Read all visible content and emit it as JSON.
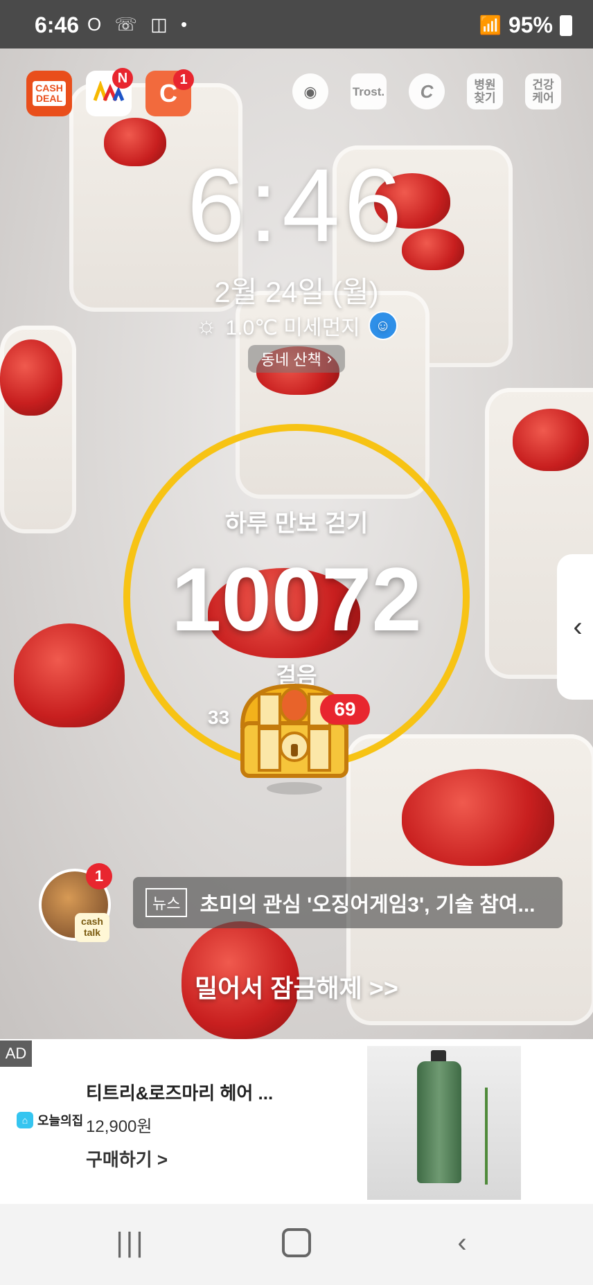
{
  "status_bar": {
    "time": "6:46",
    "left_icons": "O ☏ ◫ •",
    "battery": "95%"
  },
  "apps": [
    {
      "name": "CASH DEAL",
      "label": "CASH\nDEAL",
      "badge": ""
    },
    {
      "name": "who who",
      "label": "",
      "badge": "N"
    },
    {
      "name": "cashwalk",
      "label": "C",
      "badge": "1"
    }
  ],
  "shortcuts": [
    "",
    "Trost.",
    "C",
    "병원\n찾기",
    "건강\n케어"
  ],
  "lockscreen": {
    "clock": "6:46",
    "date": "2월 24일 (월)",
    "weather": "1.0℃ 미세먼지",
    "walk_chip": "동네 산책"
  },
  "step_widget": {
    "title": "하루 만보 걷기",
    "count": "10072",
    "unit": "걸음",
    "sub_prefix": "33",
    "reward_badge": "69",
    "progress": 1.0
  },
  "cashtalk": {
    "badge": "1",
    "label": "cash\ntalk"
  },
  "news": {
    "tag": "뉴스",
    "headline": "초미의 관심 '오징어게임3', 기술 참여..."
  },
  "unlock_text": "밀어서 잠금해제 >>",
  "ad": {
    "label": "AD",
    "brand": "오늘의집",
    "title": "티트리&로즈마리 헤어 ...",
    "price": "12,900원",
    "cta": "구매하기 >"
  },
  "colors": {
    "ring": "#f7c314",
    "badge": "#e8262f",
    "cash_deal": "#e94e1b",
    "cashwalk": "#f26a3d"
  }
}
